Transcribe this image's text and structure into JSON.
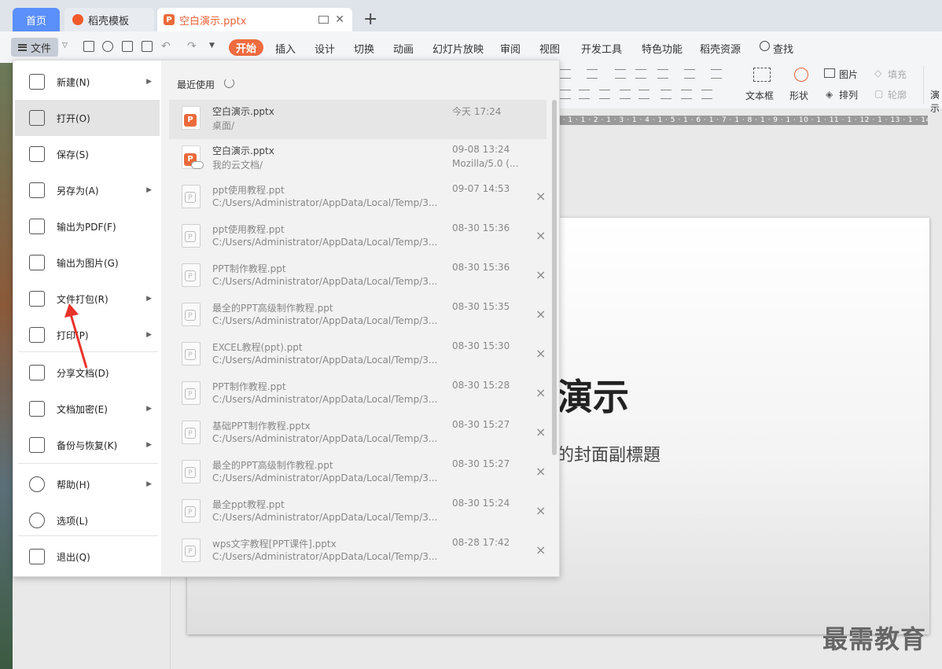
{
  "tabs": {
    "home": "首页",
    "template": "稻壳模板",
    "file": "空白演示.pptx",
    "new_tab": "+"
  },
  "toolbar": {
    "file_menu": "文件",
    "tabs": [
      "开始",
      "插入",
      "设计",
      "切换",
      "动画",
      "幻灯片放映",
      "审阅",
      "视图",
      "开发工具",
      "特色功能",
      "稻壳资源",
      "查找"
    ]
  },
  "ribbon": {
    "textbox": "文本框",
    "shape": "形状",
    "picture": "图片",
    "arrange": "排列",
    "fill": "填充",
    "outline": "轮廓",
    "presentation": "演示"
  },
  "ruler": "1 · 1 · 1 · 2 · 1 · 3 · 1 · 4 · 1 · 5 · 1 · 6 · 1 · 7 · 1 · 8 · 1 · 9 · 1 · 10 · 1 · 11 · 1 · 12 · 1 · 13 · 1 · 14 · 1 · 15 · 1 · 16 ·",
  "slide": {
    "title": "演示",
    "subtitle": "的封面副標題"
  },
  "watermark": "最需教育",
  "file_menu": {
    "items": [
      {
        "label": "新建(N)",
        "icon": "new-file-icon",
        "arrow": true
      },
      {
        "label": "打开(O)",
        "icon": "folder-open-icon",
        "arrow": false,
        "selected": true
      },
      {
        "label": "保存(S)",
        "icon": "save-icon",
        "arrow": false
      },
      {
        "label": "另存为(A)",
        "icon": "save-as-icon",
        "arrow": true
      },
      {
        "label": "输出为PDF(F)",
        "icon": "pdf-export-icon",
        "arrow": false
      },
      {
        "label": "输出为图片(G)",
        "icon": "image-export-icon",
        "arrow": false
      },
      {
        "label": "文件打包(R)",
        "icon": "package-icon",
        "arrow": true
      },
      {
        "label": "打印(P)",
        "icon": "print-icon",
        "arrow": true
      },
      {
        "label": "分享文档(D)",
        "icon": "share-icon",
        "arrow": false
      },
      {
        "label": "文档加密(E)",
        "icon": "encrypt-icon",
        "arrow": true
      },
      {
        "label": "备份与恢复(K)",
        "icon": "backup-icon",
        "arrow": true
      },
      {
        "label": "帮助(H)",
        "icon": "help-icon",
        "arrow": true
      },
      {
        "label": "选项(L)",
        "icon": "gear-icon",
        "arrow": false
      },
      {
        "label": "退出(Q)",
        "icon": "exit-icon",
        "arrow": false
      }
    ]
  },
  "recent": {
    "title": "最近使用",
    "files": [
      {
        "name": "空白演示.pptx",
        "path": "桌面/",
        "time": "今天 17:24",
        "extra": "",
        "icon": "orange",
        "closable": false
      },
      {
        "name": "空白演示.pptx",
        "path": "我的云文档/",
        "time": "09-08 13:24",
        "extra": "Mozilla/5.0 (...",
        "icon": "orange-cloud",
        "closable": false
      },
      {
        "name": "ppt使用教程.ppt",
        "path": "C:/Users/Administrator/AppData/Local/Temp/3...",
        "time": "09-07 14:53",
        "extra": "",
        "icon": "grey",
        "closable": true
      },
      {
        "name": "ppt使用教程.ppt",
        "path": "C:/Users/Administrator/AppData/Local/Temp/3...",
        "time": "08-30 15:36",
        "extra": "",
        "icon": "grey",
        "closable": true
      },
      {
        "name": "PPT制作教程.ppt",
        "path": "C:/Users/Administrator/AppData/Local/Temp/3...",
        "time": "08-30 15:36",
        "extra": "",
        "icon": "grey",
        "closable": true
      },
      {
        "name": "最全的PPT高级制作教程.ppt",
        "path": "C:/Users/Administrator/AppData/Local/Temp/3...",
        "time": "08-30 15:35",
        "extra": "",
        "icon": "grey",
        "closable": true
      },
      {
        "name": "EXCEL教程(ppt).ppt",
        "path": "C:/Users/Administrator/AppData/Local/Temp/3...",
        "time": "08-30 15:30",
        "extra": "",
        "icon": "grey",
        "closable": true
      },
      {
        "name": "PPT制作教程.ppt",
        "path": "C:/Users/Administrator/AppData/Local/Temp/3...",
        "time": "08-30 15:28",
        "extra": "",
        "icon": "grey",
        "closable": true
      },
      {
        "name": "基础PPT制作教程.pptx",
        "path": "C:/Users/Administrator/AppData/Local/Temp/3...",
        "time": "08-30 15:27",
        "extra": "",
        "icon": "grey",
        "closable": true
      },
      {
        "name": "最全的PPT高级制作教程.ppt",
        "path": "C:/Users/Administrator/AppData/Local/Temp/3...",
        "time": "08-30 15:27",
        "extra": "",
        "icon": "grey",
        "closable": true
      },
      {
        "name": "最全ppt教程.ppt",
        "path": "C:/Users/Administrator/AppData/Local/Temp/3...",
        "time": "08-30 15:24",
        "extra": "",
        "icon": "grey",
        "closable": true
      },
      {
        "name": "wps文字教程[PPT课件].pptx",
        "path": "C:/Users/Administrator/AppData/Local/Temp/3...",
        "time": "08-28 17:42",
        "extra": "",
        "icon": "grey",
        "closable": true
      }
    ],
    "close_symbol": "×"
  },
  "colors": {
    "accent": "#ee6b3f",
    "home_tab": "#5b8ff9",
    "annotation": "#e8322a"
  }
}
